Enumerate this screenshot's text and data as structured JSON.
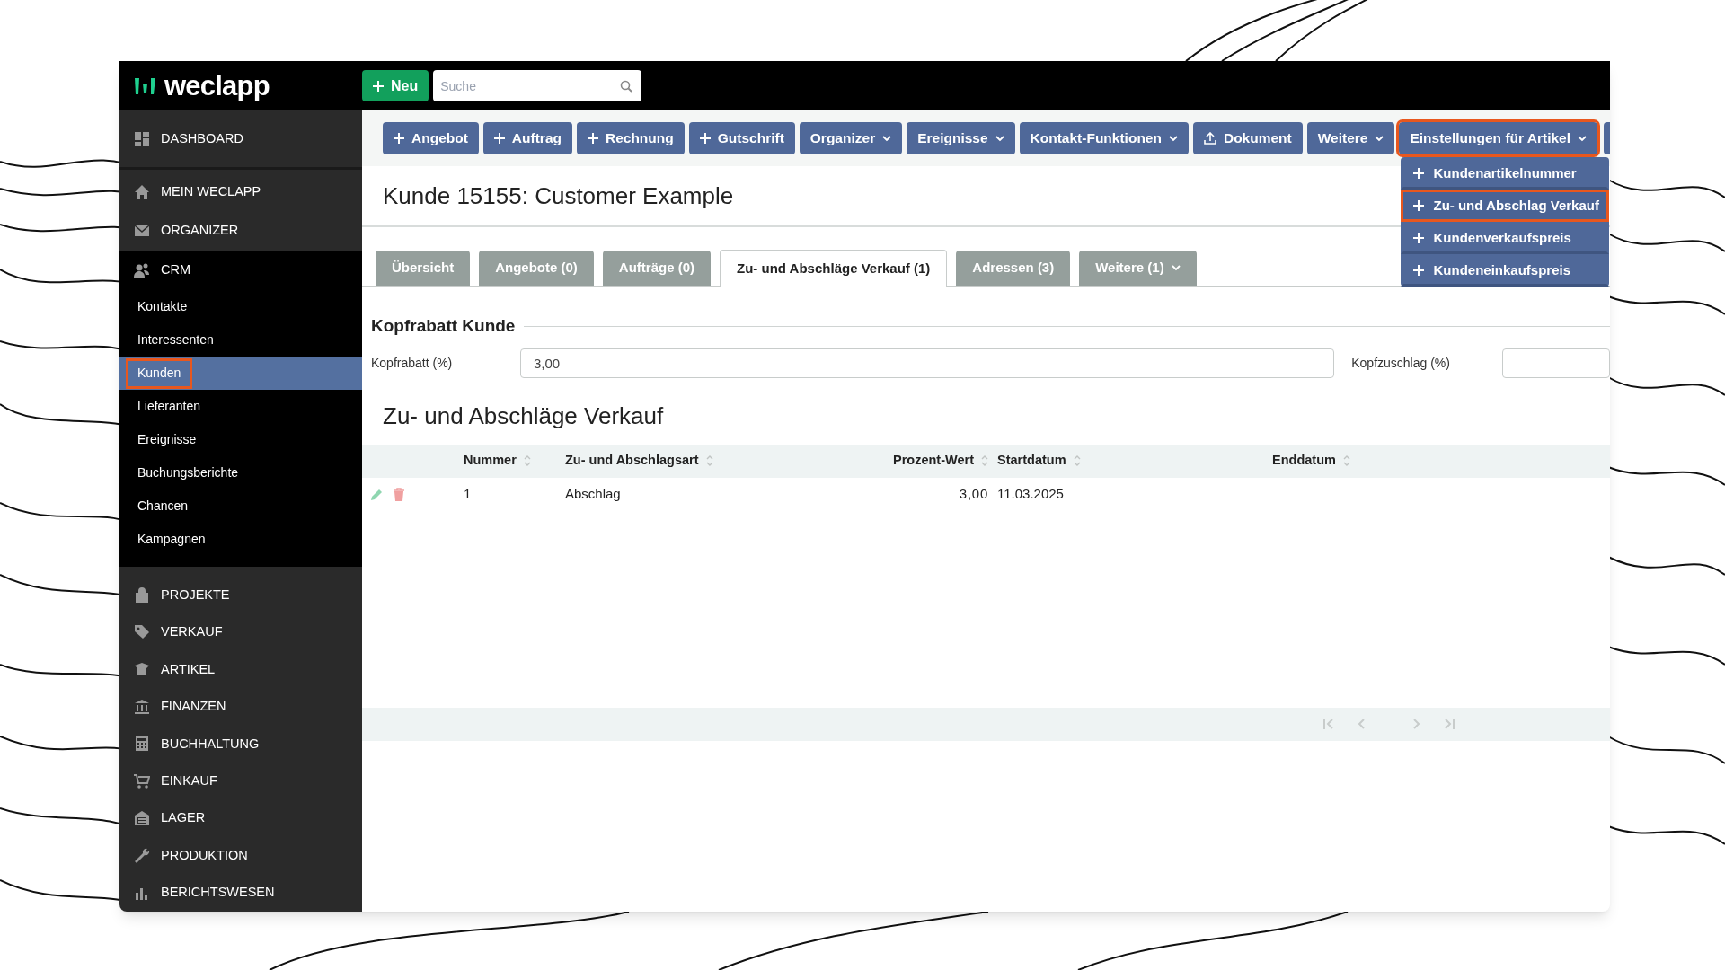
{
  "app": {
    "logo": "weclapp",
    "new_button": "Neu",
    "search": {
      "placeholder": "Suche"
    }
  },
  "sidebar": {
    "items": [
      {
        "label": "DASHBOARD",
        "expanded": false
      },
      {
        "label": "MEIN WECLAPP",
        "expanded": false
      },
      {
        "label": "ORGANIZER",
        "expanded": false
      },
      {
        "label": "CRM",
        "expanded": true,
        "children": [
          {
            "label": "Kontakte",
            "selected": false,
            "highlighted": false
          },
          {
            "label": "Interessenten",
            "selected": false,
            "highlighted": false
          },
          {
            "label": "Kunden",
            "selected": true,
            "highlighted": true
          },
          {
            "label": "Lieferanten",
            "selected": false,
            "highlighted": false
          },
          {
            "label": "Ereignisse",
            "selected": false,
            "highlighted": false
          },
          {
            "label": "Buchungsberichte",
            "selected": false,
            "highlighted": false
          },
          {
            "label": "Chancen",
            "selected": false,
            "highlighted": false
          },
          {
            "label": "Kampagnen",
            "selected": false,
            "highlighted": false
          }
        ]
      },
      {
        "label": "PROJEKTE",
        "expanded": false
      },
      {
        "label": "VERKAUF",
        "expanded": false
      },
      {
        "label": "ARTIKEL",
        "expanded": false
      },
      {
        "label": "FINANZEN",
        "expanded": false
      },
      {
        "label": "BUCHHALTUNG",
        "expanded": false
      },
      {
        "label": "EINKAUF",
        "expanded": false
      },
      {
        "label": "LAGER",
        "expanded": false
      },
      {
        "label": "PRODUKTION",
        "expanded": false
      },
      {
        "label": "BERICHTSWESEN",
        "expanded": false
      }
    ]
  },
  "toolbar": {
    "buttons": [
      {
        "label": "Angebot",
        "kind": "add",
        "highlighted": false
      },
      {
        "label": "Auftrag",
        "kind": "add",
        "highlighted": false
      },
      {
        "label": "Rechnung",
        "kind": "add",
        "highlighted": false
      },
      {
        "label": "Gutschrift",
        "kind": "add",
        "highlighted": false
      },
      {
        "label": "Organizer",
        "kind": "dropdown",
        "highlighted": false
      },
      {
        "label": "Ereignisse",
        "kind": "dropdown",
        "highlighted": false
      },
      {
        "label": "Kontakt-Funktionen",
        "kind": "dropdown",
        "highlighted": false
      },
      {
        "label": "Dokument",
        "kind": "upload",
        "highlighted": false
      },
      {
        "label": "Weitere",
        "kind": "dropdown",
        "highlighted": false
      },
      {
        "label": "Einstellungen für Artikel",
        "kind": "dropdown",
        "highlighted": true,
        "expanded": true,
        "menu": [
          {
            "label": "Kundenartikelnummer",
            "highlighted": false
          },
          {
            "label": "Zu- und Abschlag Verkauf",
            "highlighted": true
          },
          {
            "label": "Kundenverkaufspreis",
            "highlighted": false
          },
          {
            "label": "Kundeneinkaufspreis",
            "highlighted": false
          }
        ]
      }
    ]
  },
  "page_title": "Kunde 15155: Customer Example",
  "tabs": [
    {
      "label": "Übersicht",
      "selected": false,
      "kind": "plain"
    },
    {
      "label": "Angebote (0)",
      "selected": false,
      "kind": "plain"
    },
    {
      "label": "Aufträge (0)",
      "selected": false,
      "kind": "plain"
    },
    {
      "label": "Zu- und Abschläge Verkauf (1)",
      "selected": true,
      "kind": "plain"
    },
    {
      "label": "Adressen (3)",
      "selected": false,
      "kind": "plain"
    },
    {
      "label": "Weitere (1)",
      "selected": false,
      "kind": "dropdown"
    }
  ],
  "discount_section": {
    "title": "Kopfrabatt Kunde",
    "fields": [
      {
        "label": "Kopfrabatt (%)",
        "value": "3,00"
      },
      {
        "label": "Kopfzuschlag (%)"
      }
    ]
  },
  "table": {
    "title": "Zu- und Abschläge Verkauf",
    "columns": [
      {
        "label": "Nummer"
      },
      {
        "label": "Zu- und Abschlagsart"
      },
      {
        "label": "Prozent-Wert"
      },
      {
        "label": "Startdatum"
      },
      {
        "label": "Enddatum"
      }
    ],
    "rows": [
      {
        "cells": [
          "1",
          "Abschlag",
          "3,00",
          "11.03.2025"
        ]
      }
    ]
  }
}
